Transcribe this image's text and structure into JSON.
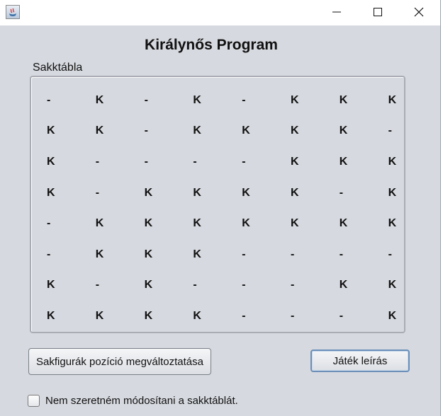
{
  "window": {
    "title": "",
    "controls": [
      "minimize-icon",
      "maximize-icon",
      "close-icon"
    ]
  },
  "heading": "Királynős Program",
  "board": {
    "label": "Sakktábla",
    "rows": [
      [
        "-",
        "K",
        "-",
        "K",
        "-",
        "K",
        "K",
        "K"
      ],
      [
        "K",
        "K",
        "-",
        "K",
        "K",
        "K",
        "K",
        "-"
      ],
      [
        "K",
        "-",
        "-",
        "-",
        "-",
        "K",
        "K",
        "K"
      ],
      [
        "K",
        "-",
        "K",
        "K",
        "K",
        "K",
        "-",
        "K"
      ],
      [
        "-",
        "K",
        "K",
        "K",
        "K",
        "K",
        "K",
        "K"
      ],
      [
        "-",
        "K",
        "K",
        "K",
        "-",
        "-",
        "-",
        "-"
      ],
      [
        "K",
        "-",
        "K",
        "-",
        "-",
        "-",
        "K",
        "K"
      ],
      [
        "K",
        "K",
        "K",
        "K",
        "-",
        "-",
        "-",
        "K"
      ]
    ]
  },
  "buttons": {
    "change_positions": "Sakfigurák pozíció megváltoztatása",
    "game_description": "Játék leírás"
  },
  "checkbox": {
    "label": "Nem szeretném módosítani a sakktáblát.",
    "checked": false
  }
}
